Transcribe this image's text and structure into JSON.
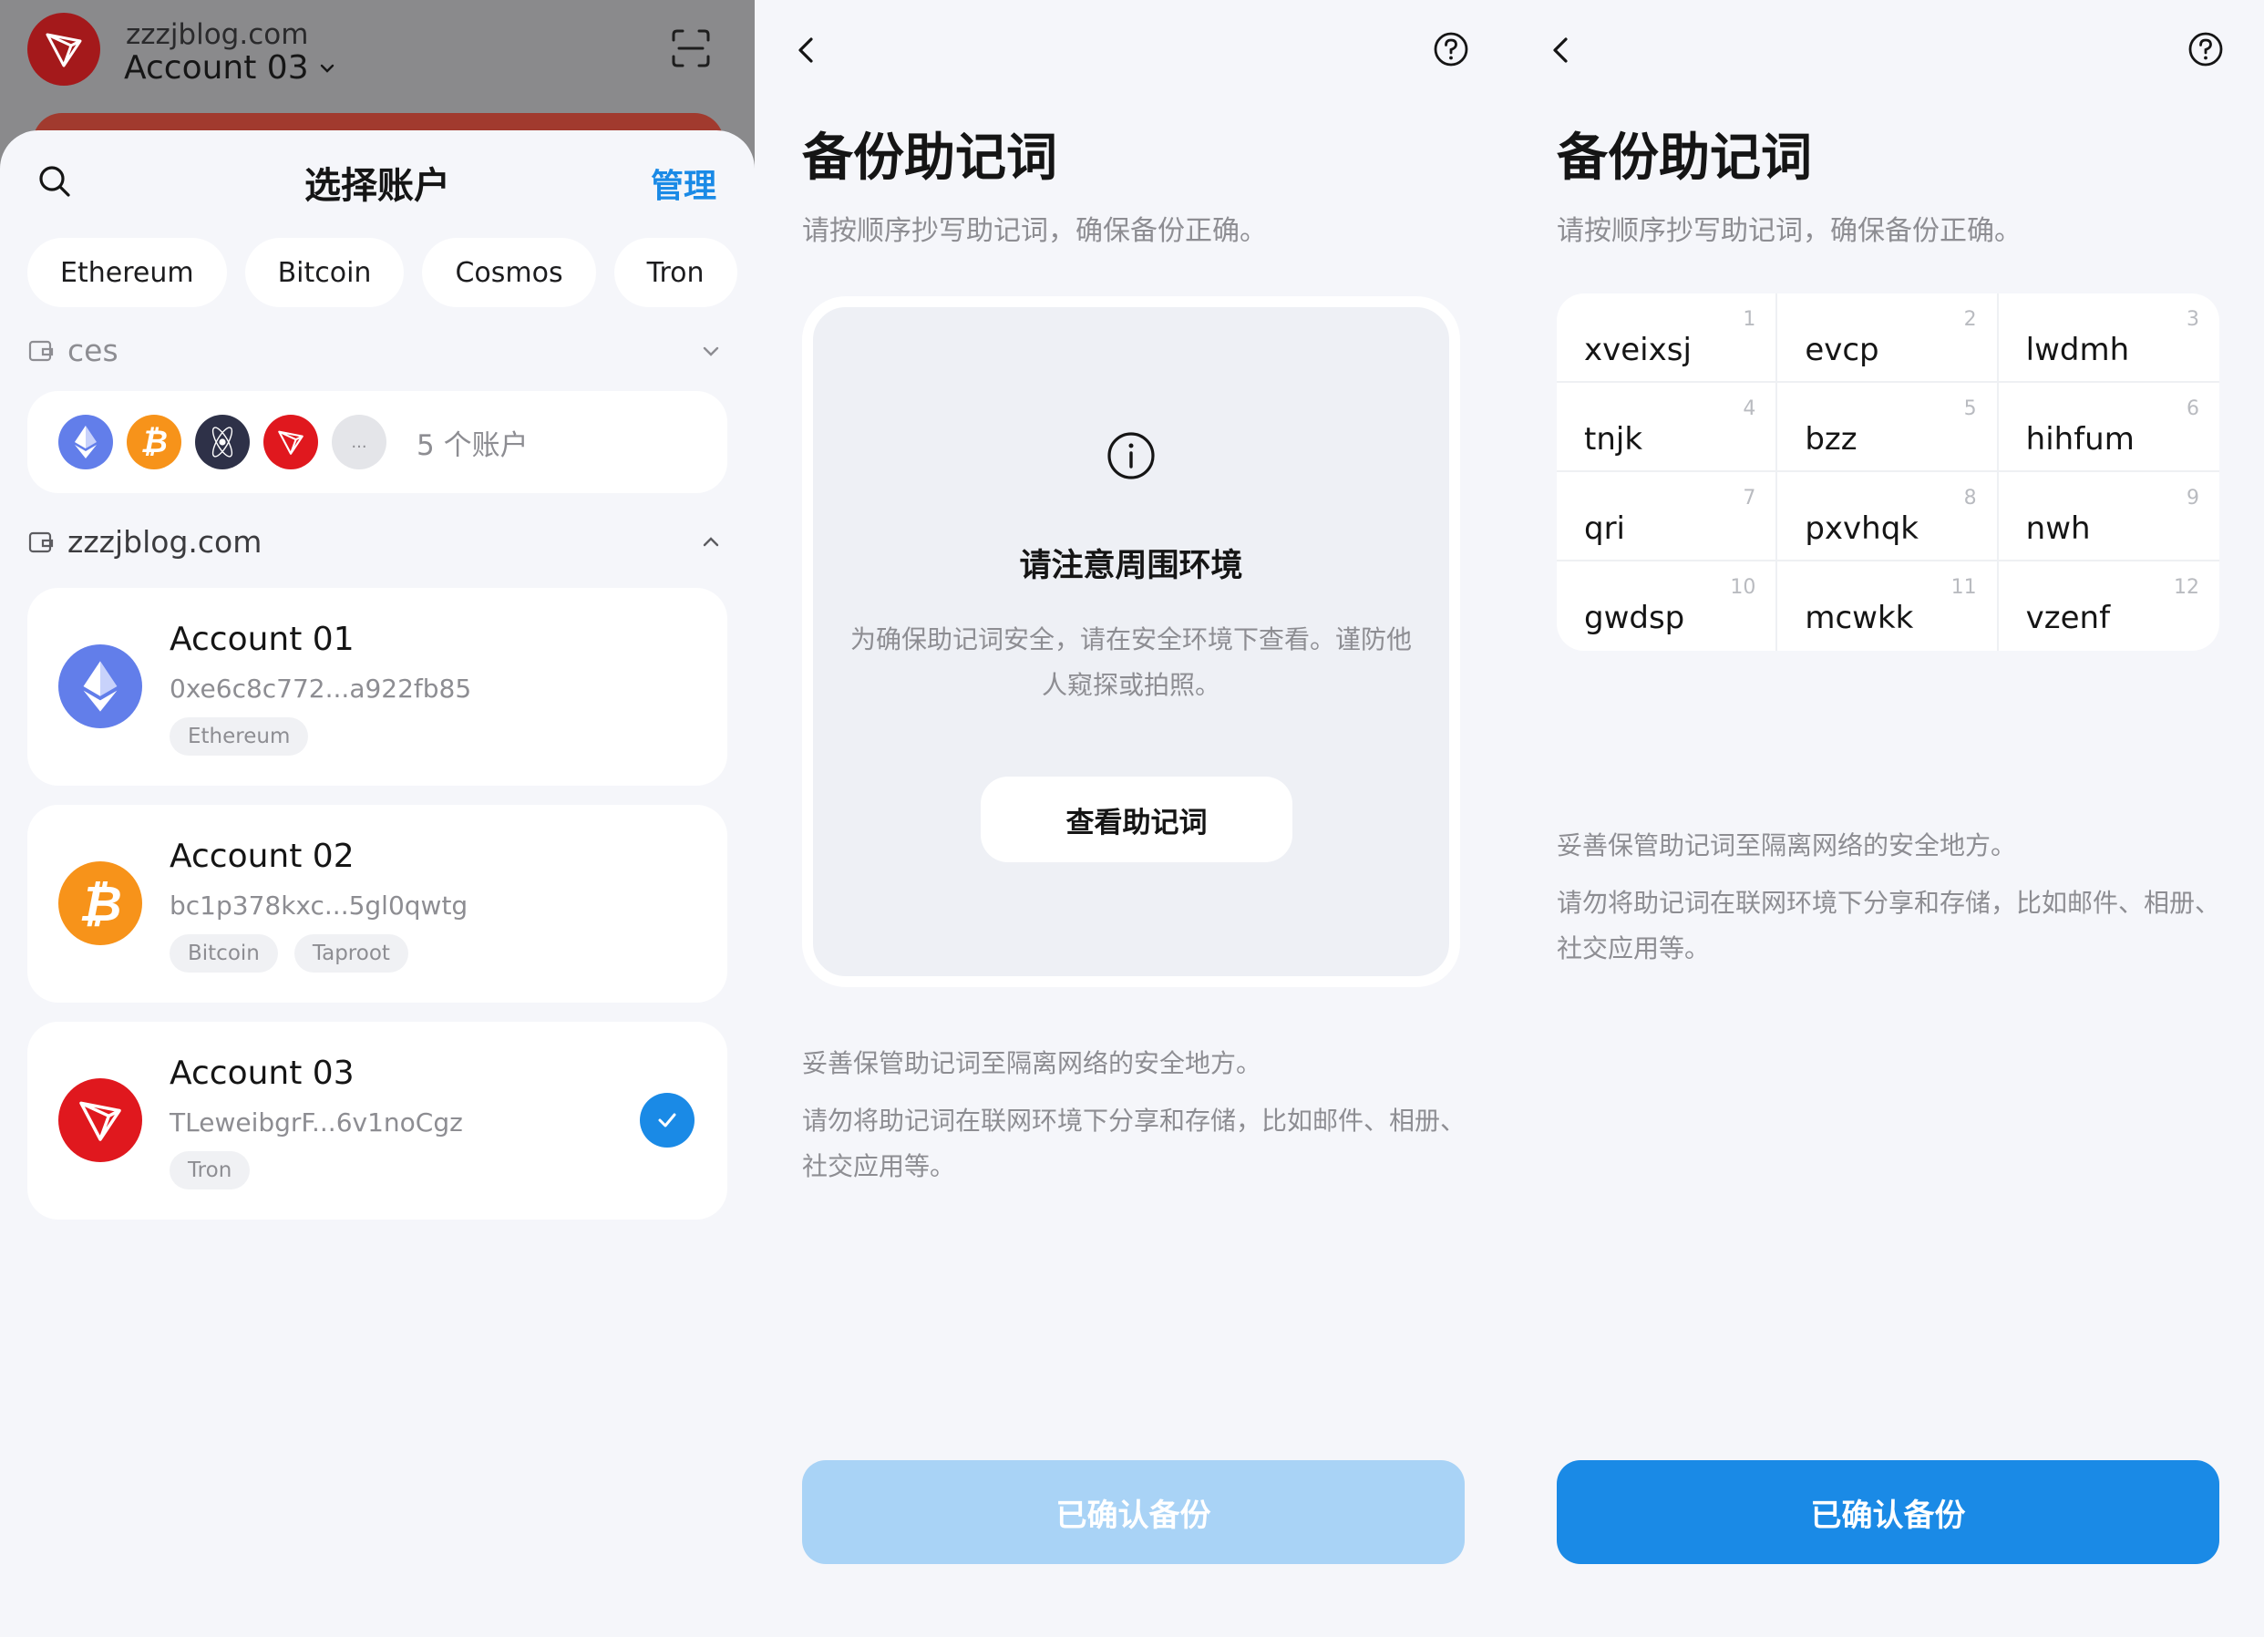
{
  "colors": {
    "accent": "#1a8ae6",
    "confirm_disabled": "#a9d3f6",
    "eth": "#627eea",
    "btc": "#f7931a",
    "tron": "#e0181e",
    "cosmos": "#2e3148"
  },
  "account_picker": {
    "top_bar": {
      "domain": "zzzjblog.com",
      "account": "Account 03",
      "icon": "tron-logo-icon",
      "action_icon": "scan-icon"
    },
    "sheet_title": "选择账户",
    "manage_label": "管理",
    "chain_filters": [
      "Ethereum",
      "Bitcoin",
      "Cosmos",
      "Tron"
    ],
    "groups": [
      {
        "name": "ces",
        "collapsed": true,
        "coins": [
          "ethereum-icon",
          "bitcoin-icon",
          "cosmos-icon",
          "tron-icon"
        ],
        "more_label": "...",
        "count_label": "5 个账户"
      },
      {
        "name": "zzzjblog.com",
        "collapsed": false,
        "accounts": [
          {
            "name": "Account 01",
            "address": "0xe6c8c772...a922fb85",
            "tags": [
              "Ethereum"
            ],
            "icon": "ethereum-icon",
            "selected": false
          },
          {
            "name": "Account 02",
            "address": "bc1p378kxc...5gl0qwtg",
            "tags": [
              "Bitcoin",
              "Taproot"
            ],
            "icon": "bitcoin-icon",
            "selected": false
          },
          {
            "name": "Account 03",
            "address": "TLeweibgrF...6v1noCgz",
            "tags": [
              "Tron"
            ],
            "icon": "tron-icon",
            "selected": true
          }
        ]
      }
    ]
  },
  "backup_hidden": {
    "title": "备份助记词",
    "subtitle": "请按顺序抄写助记词，确保备份正确。",
    "notice_title": "请注意周围环境",
    "notice_text": "为确保助记词安全，请在安全环境下查看。谨防他人窥探或拍照。",
    "view_button": "查看助记词",
    "tip1": "妥善保管助记词至隔离网络的安全地方。",
    "tip2": "请勿将助记词在联网环境下分享和存储，比如邮件、相册、社交应用等。",
    "confirm_button": "已确认备份",
    "confirm_enabled": false
  },
  "backup_shown": {
    "title": "备份助记词",
    "subtitle": "请按顺序抄写助记词，确保备份正确。",
    "words": [
      {
        "n": "1",
        "w": "xveixsj"
      },
      {
        "n": "2",
        "w": "evcp"
      },
      {
        "n": "3",
        "w": "lwdmh"
      },
      {
        "n": "4",
        "w": "tnjk"
      },
      {
        "n": "5",
        "w": "bzz"
      },
      {
        "n": "6",
        "w": "hihfum"
      },
      {
        "n": "7",
        "w": "qri"
      },
      {
        "n": "8",
        "w": "pxvhqk"
      },
      {
        "n": "9",
        "w": "nwh"
      },
      {
        "n": "10",
        "w": "gwdsp"
      },
      {
        "n": "11",
        "w": "mcwkk"
      },
      {
        "n": "12",
        "w": "vzenf"
      }
    ],
    "tip1": "妥善保管助记词至隔离网络的安全地方。",
    "tip2": "请勿将助记词在联网环境下分享和存储，比如邮件、相册、社交应用等。",
    "confirm_button": "已确认备份",
    "confirm_enabled": true
  }
}
